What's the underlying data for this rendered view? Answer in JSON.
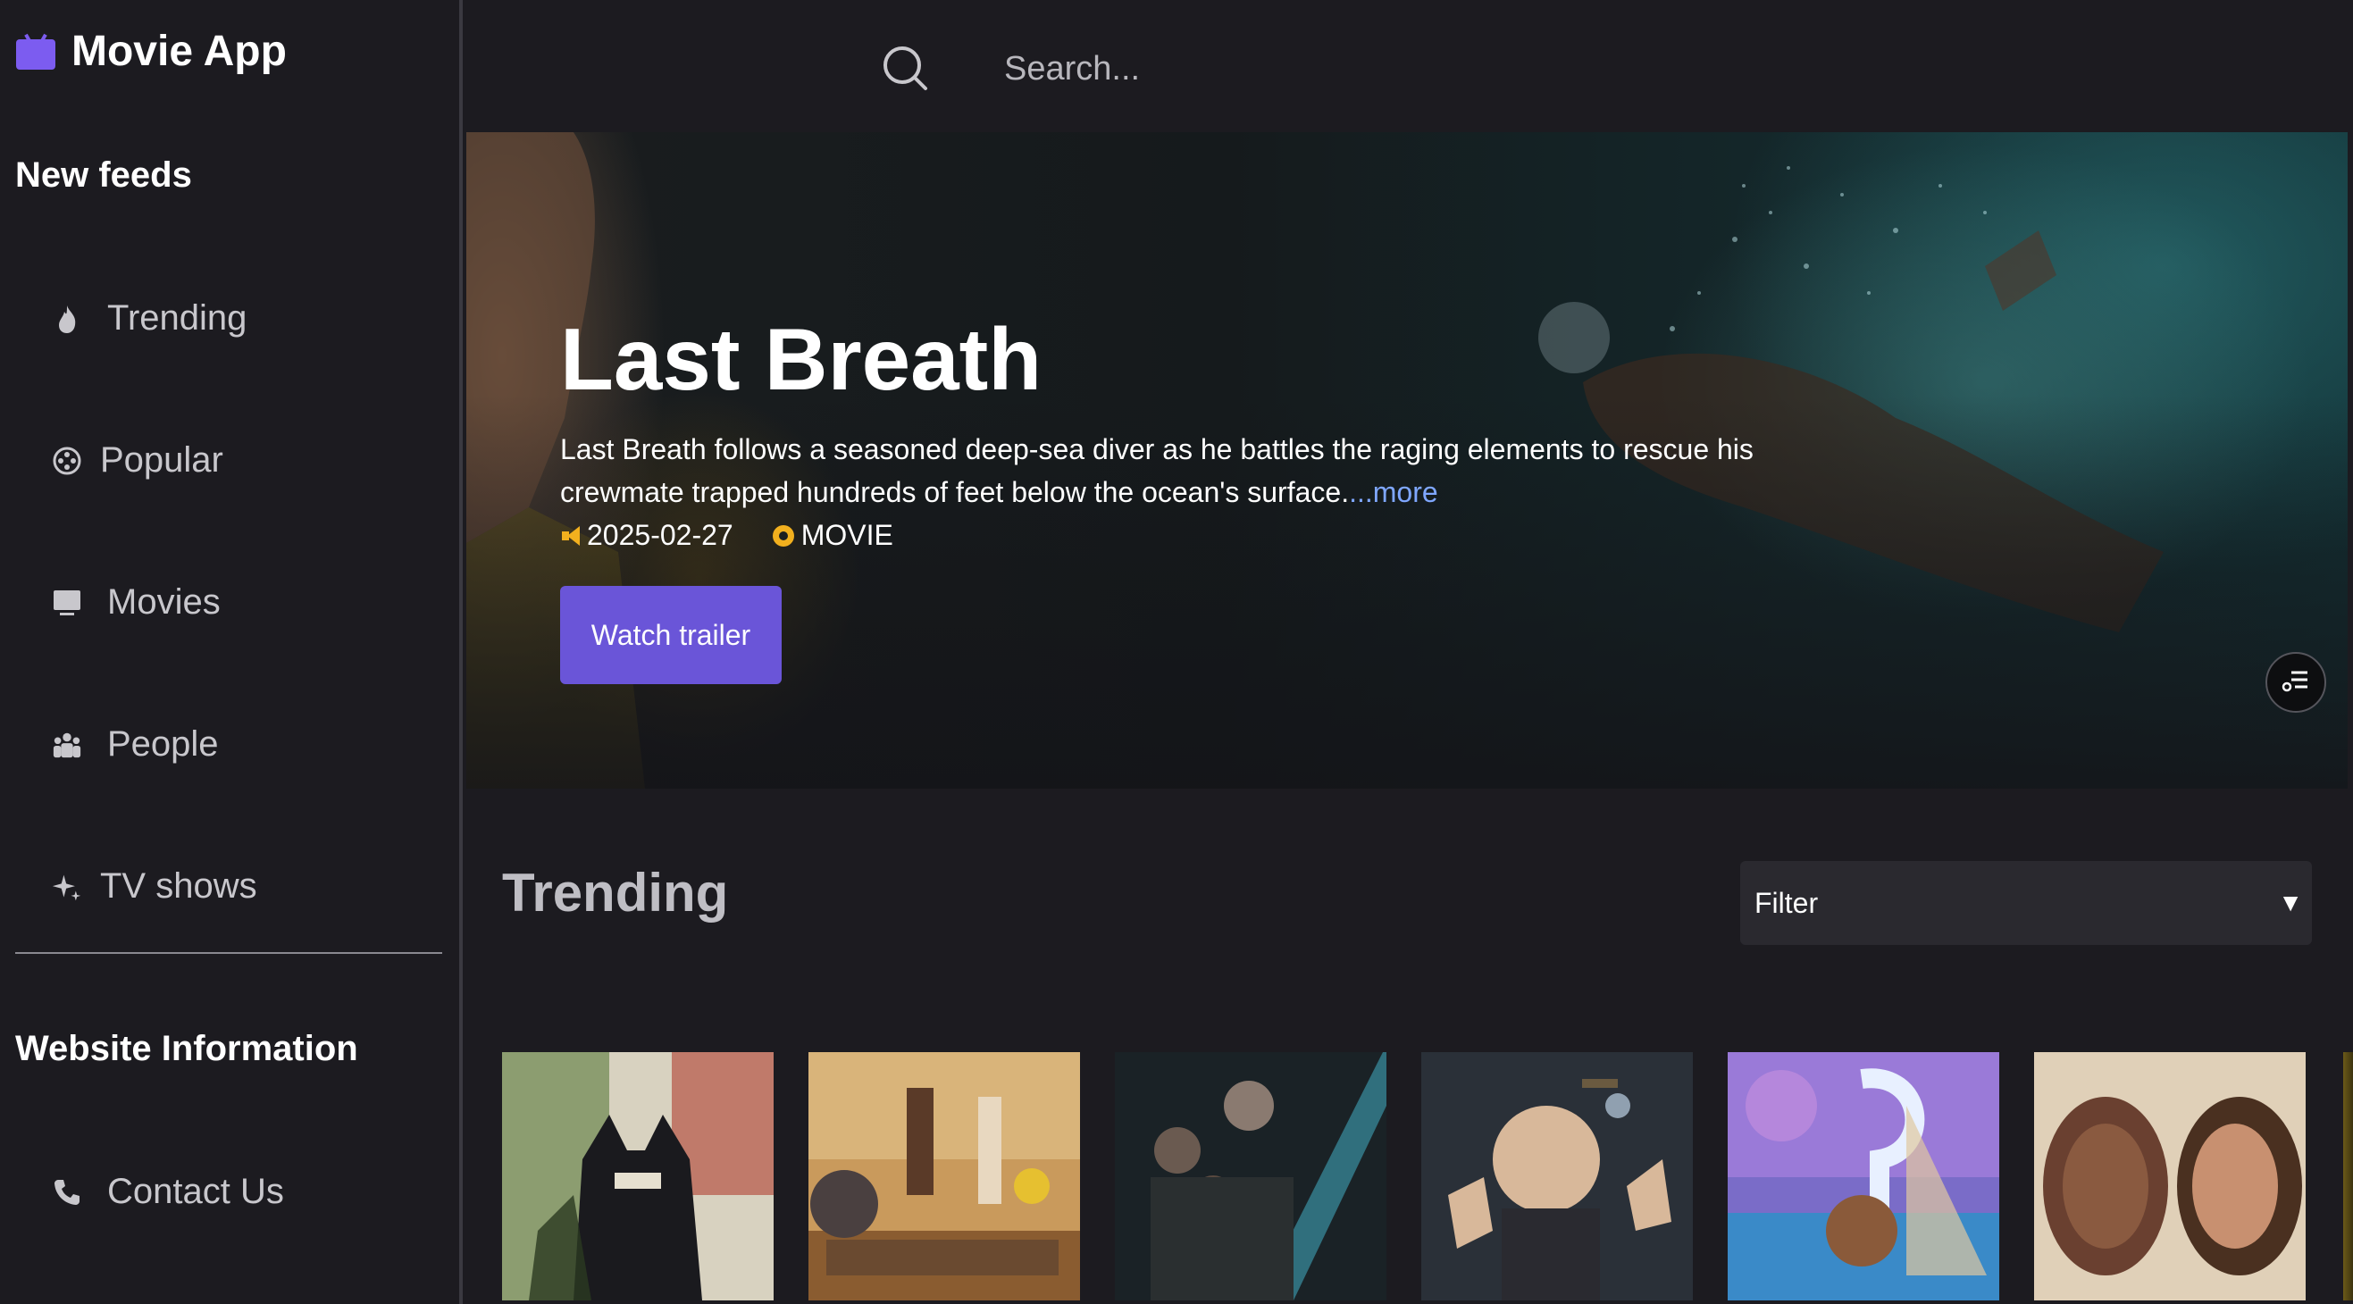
{
  "app": {
    "title": "Movie App",
    "accent_color": "#6a55d8",
    "logo_icon": "tv-icon"
  },
  "sidebar": {
    "section_feeds": "New feeds",
    "items": [
      {
        "label": "Trending",
        "icon": "flame-icon"
      },
      {
        "label": "Popular",
        "icon": "film-reel-icon"
      },
      {
        "label": "Movies",
        "icon": "monitor-icon"
      },
      {
        "label": "People",
        "icon": "people-icon"
      },
      {
        "label": "TV shows",
        "icon": "sparkle-icon"
      }
    ],
    "section_info": "Website Information",
    "info_items": [
      {
        "label": "Contact Us",
        "icon": "phone-icon"
      }
    ]
  },
  "search": {
    "placeholder": "Search...",
    "icon": "search-icon"
  },
  "hero": {
    "title": "Last Breath",
    "description": "Last Breath follows a seasoned deep-sea diver as he battles the raging elements to rescue his crewmate trapped hundreds of feet below the ocean's surface.",
    "more_label": "...more",
    "release_date": "2025-02-27",
    "media_type": "MOVIE",
    "button_label": "Watch trailer"
  },
  "trending": {
    "title": "Trending",
    "filter_label": "Filter",
    "filter_arrow": "▼"
  }
}
